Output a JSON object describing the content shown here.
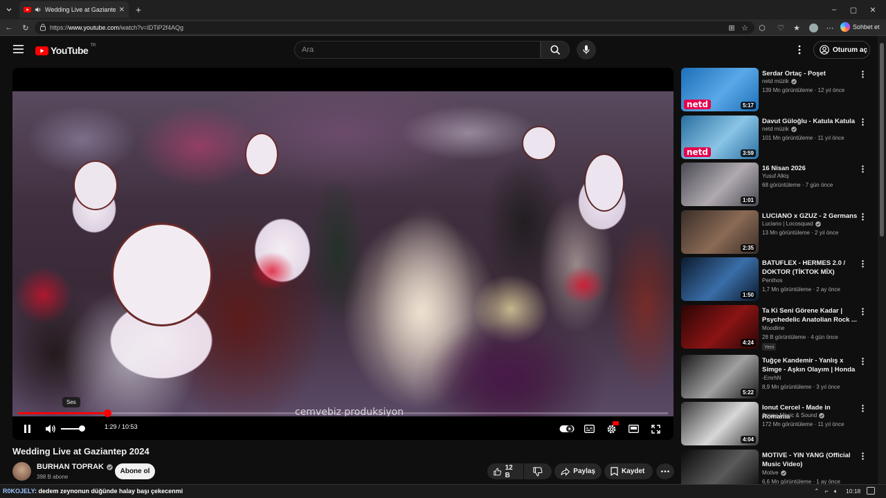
{
  "browser": {
    "tab_title": "Wedding Live at Gaziantep 2024",
    "url_prefix": "https://",
    "url_domain": "www.youtube.com",
    "url_path": "/watch?v=lDTiP2f4AQg",
    "copilot_label": "Sohbet et"
  },
  "youtube": {
    "logo_text": "YouTube",
    "region": "TR",
    "search_placeholder": "Ara",
    "signin_label": "Oturum aç"
  },
  "player": {
    "watermark": "cemvebiz produksiyon",
    "tooltip": "Ses",
    "time_current": "1:29",
    "time_separator": " / ",
    "time_total": "10:53",
    "progress_fraction": 0.137,
    "volume_fraction": 0.95
  },
  "video": {
    "title": "Wedding Live at Gaziantep 2024",
    "channel": "BURHAN TOPRAK",
    "subscribers": "398 B abone",
    "subscribe_label": "Abone ol",
    "likes": "12 B",
    "share_label": "Paylaş",
    "save_label": "Kaydet"
  },
  "sidebar": [
    {
      "title": "Serdar Ortaç - Poşet",
      "channel": "netd müzik",
      "verified": true,
      "meta": "139 Mn görüntüleme · 12 yıl önce",
      "duration": "5:17",
      "badge": "",
      "logo": "netd",
      "colors": [
        "#1d6fb8",
        "#5aa8e8"
      ]
    },
    {
      "title": "Davut Güloğlu - Katula Katula",
      "channel": "netd müzik",
      "verified": true,
      "meta": "101 Mn görüntüleme · 11 yıl önce",
      "duration": "3:59",
      "badge": "",
      "logo": "netd",
      "colors": [
        "#2a6fa0",
        "#8ac4e6"
      ]
    },
    {
      "title": "16 Nisan 2026",
      "channel": "Yusuf Alkiş",
      "verified": false,
      "meta": "68 görüntüleme · 7 gün önce",
      "duration": "1:01",
      "badge": "",
      "logo": "",
      "colors": [
        "#4a4a52",
        "#b0aab0"
      ]
    },
    {
      "title": "LUCIANO x GZUZ - 2 Germans",
      "channel": "Luciano | Locosquad",
      "verified": true,
      "meta": "13 Mn görüntüleme · 2 yıl önce",
      "duration": "2:35",
      "badge": "",
      "logo": "",
      "colors": [
        "#3a2e28",
        "#8a6a55"
      ]
    },
    {
      "title": "BATUFLEX - HERMES 2.0 / DOKTOR (TİKTOK MİX)",
      "channel": "Penthos",
      "verified": false,
      "meta": "1,7 Mn görüntüleme · 2 ay önce",
      "duration": "1:50",
      "badge": "",
      "logo": "",
      "colors": [
        "#0c1a2e",
        "#3a6ea8"
      ]
    },
    {
      "title": "Ta Ki Seni Görene Kadar | Psychedelic Anatolian Rock ...",
      "channel": "Moodline",
      "verified": false,
      "meta": "28 B görüntüleme · 4 gün önce",
      "duration": "4:24",
      "badge": "Yeni",
      "logo": "",
      "colors": [
        "#2a0505",
        "#8a1414"
      ]
    },
    {
      "title": "Tuğçe Kandemir - Yanlış x Simge - Aşkın Olayım | Honda ...",
      "channel": "-EmrhN",
      "verified": false,
      "meta": "8,9 Mn görüntüleme · 3 yıl önce",
      "duration": "5:22",
      "badge": "",
      "logo": "",
      "colors": [
        "#1a1a1a",
        "#a0a0a0"
      ]
    },
    {
      "title": "Ionut Cercel - Made in Romania",
      "channel": "Amma Music & Sound",
      "verified": true,
      "meta": "172 Mn görüntüleme · 11 yıl önce",
      "duration": "4:04",
      "badge": "",
      "logo": "",
      "colors": [
        "#3a3a3a",
        "#d8d8d8"
      ]
    },
    {
      "title": "MOTIVE - YIN YANG (Official Music Video)",
      "channel": "Motive",
      "verified": true,
      "meta": "6,6 Mn görüntüleme · 1 ay önce",
      "duration": "",
      "badge": "",
      "logo": "",
      "colors": [
        "#0a0a0a",
        "#5a5a5a"
      ]
    }
  ],
  "taskbar": {
    "ticker_user": "R0KOJELY",
    "ticker_text": ": dedem zeynonun düğünde halay başı çekecenmi",
    "clock": "10:18"
  }
}
